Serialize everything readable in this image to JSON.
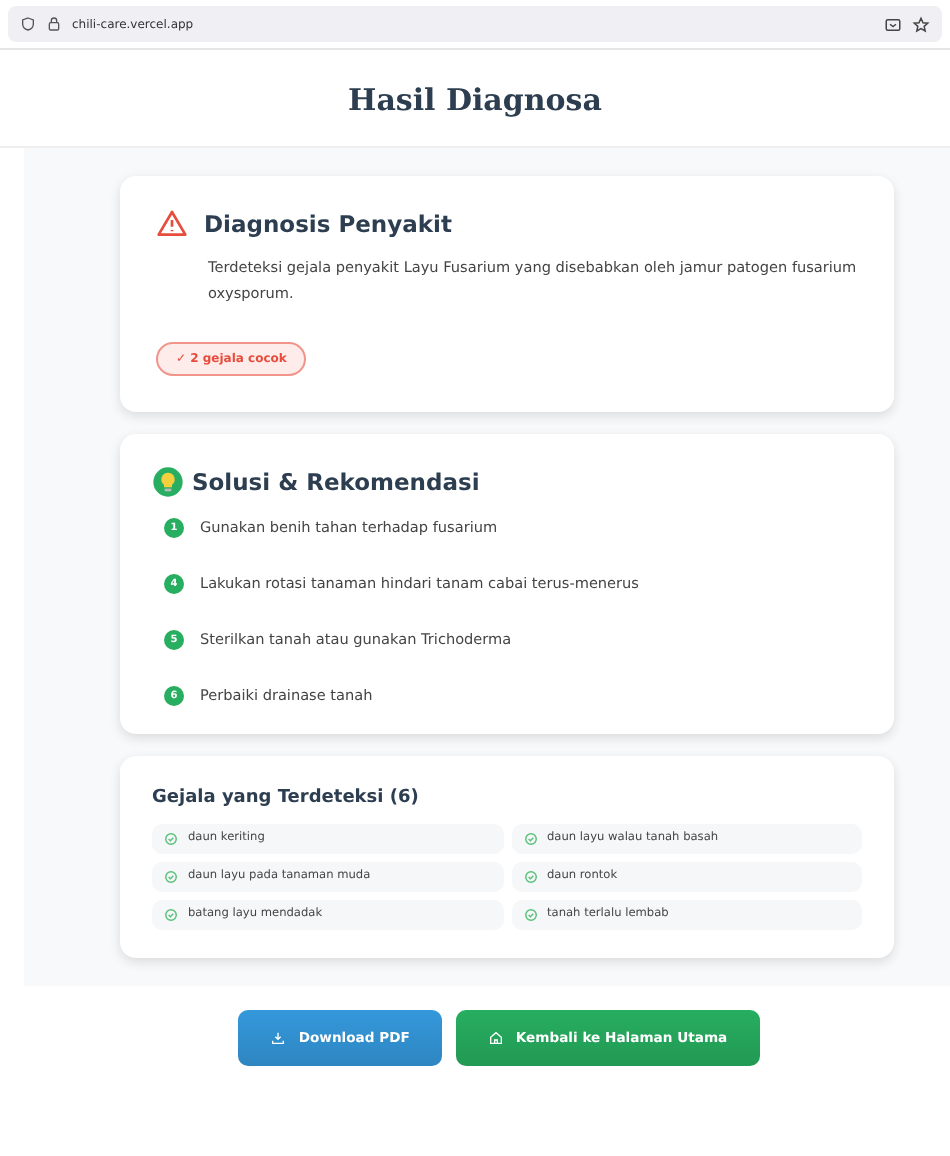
{
  "browser": {
    "url": "chili-care.vercel.app"
  },
  "page_title": "Hasil Diagnosa",
  "diagnosis": {
    "title": "Diagnosis Penyakit",
    "description": "Terdeteksi gejala penyakit Layu Fusarium yang disebabkan oleh jamur patogen fusarium oxysporum.",
    "match_badge": "✓ 2 gejala cocok"
  },
  "solutions": {
    "title": "Solusi & Rekomendasi",
    "items": [
      {
        "number": "1",
        "text": "Gunakan benih tahan terhadap fusarium"
      },
      {
        "number": "4",
        "text": "Lakukan rotasi tanaman hindari tanam cabai terus-menerus"
      },
      {
        "number": "5",
        "text": "Sterilkan tanah atau gunakan Trichoderma"
      },
      {
        "number": "6",
        "text": "Perbaiki drainase tanah"
      }
    ]
  },
  "symptoms": {
    "title": "Gejala yang Terdeteksi (6)",
    "items": [
      "daun keriting",
      "daun layu walau tanah basah",
      "daun layu pada tanaman muda",
      "daun rontok",
      "batang layu mendadak",
      "tanah terlalu lembab"
    ]
  },
  "buttons": [
    {
      "kind": "download",
      "label": "Download PDF"
    },
    {
      "kind": "home",
      "label": "Kembali ke Halaman Utama"
    }
  ]
}
